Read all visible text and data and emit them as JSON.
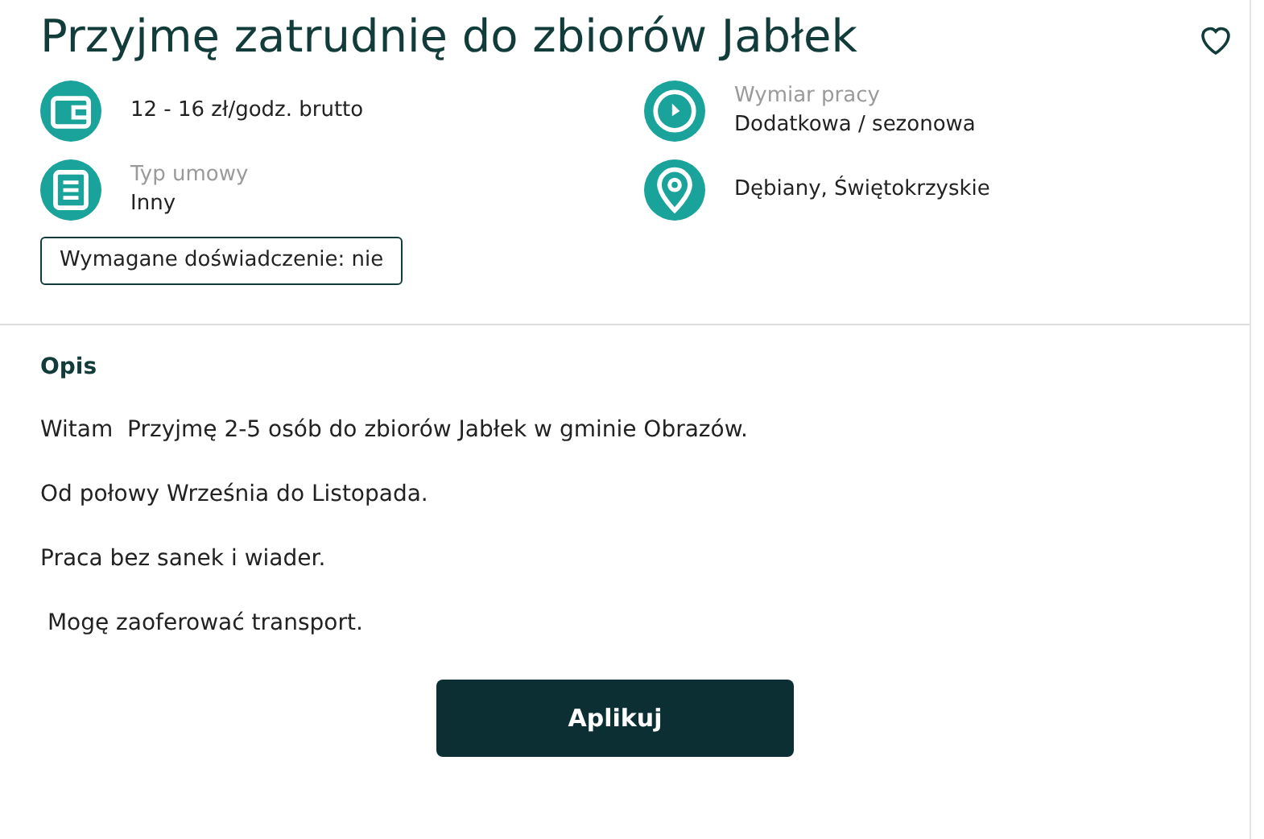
{
  "title": "Przyjmę zatrudnię do zbiorów Jabłek",
  "favorite": {
    "selected": false
  },
  "details": [
    {
      "value": "12 - 16 zł/godz. brutto"
    },
    {
      "label": "Typ umowy",
      "value": "Inny"
    },
    {
      "label": "Wymiar pracy",
      "value": "Dodatkowa / sezonowa"
    },
    {
      "value": "Dębiany, Świętokrzyskie"
    }
  ],
  "tags": [
    "Wymagane doświadczenie: nie"
  ],
  "description": {
    "heading": "Opis",
    "paragraphs": [
      "Witam  Przyjmę 2-5 osób do zbiorów Jabłek w gminie Obrazów.",
      "Od połowy Września do Listopada.",
      "Praca bez sanek i wiader.",
      " Mogę zaoferować transport."
    ]
  },
  "apply_button": "Aplikuj"
}
